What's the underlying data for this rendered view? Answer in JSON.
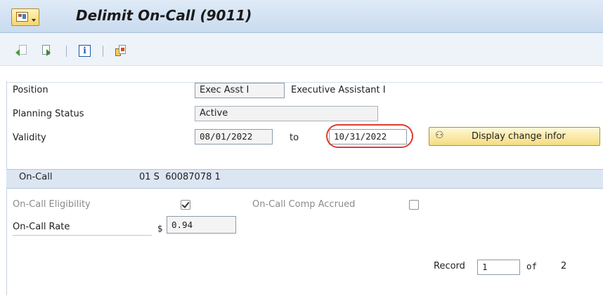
{
  "title": "Delimit On-Call (9011)",
  "toolbar": {
    "icons": [
      "previous-record-icon",
      "next-record-icon",
      "information-icon",
      "other-icon"
    ]
  },
  "header": {
    "position_label": "Position",
    "position_code": "Exec Asst I",
    "position_text": "Executive Assistant I",
    "planning_status_label": "Planning Status",
    "planning_status_value": "Active",
    "validity_label": "Validity",
    "valid_from": "08/01/2022",
    "to_label": "to",
    "valid_to": "10/31/2022",
    "display_change_button": "Display change infor"
  },
  "panel": {
    "title": "On-Call",
    "key": "01 S  60087078 1",
    "eligibility_label": "On-Call Eligibility",
    "eligibility_checked": true,
    "comp_accrued_label": "On-Call Comp Accrued",
    "comp_accrued_checked": false,
    "rate_label": "On-Call Rate",
    "currency_symbol": "$",
    "rate_value": "0.94"
  },
  "record": {
    "label": "Record",
    "current": "1",
    "of_label": "of",
    "total": "2"
  },
  "colors": {
    "highlight_ring": "#e03b2f",
    "title_bar": "#c9dbef",
    "button_gold": "#f6dc80"
  }
}
